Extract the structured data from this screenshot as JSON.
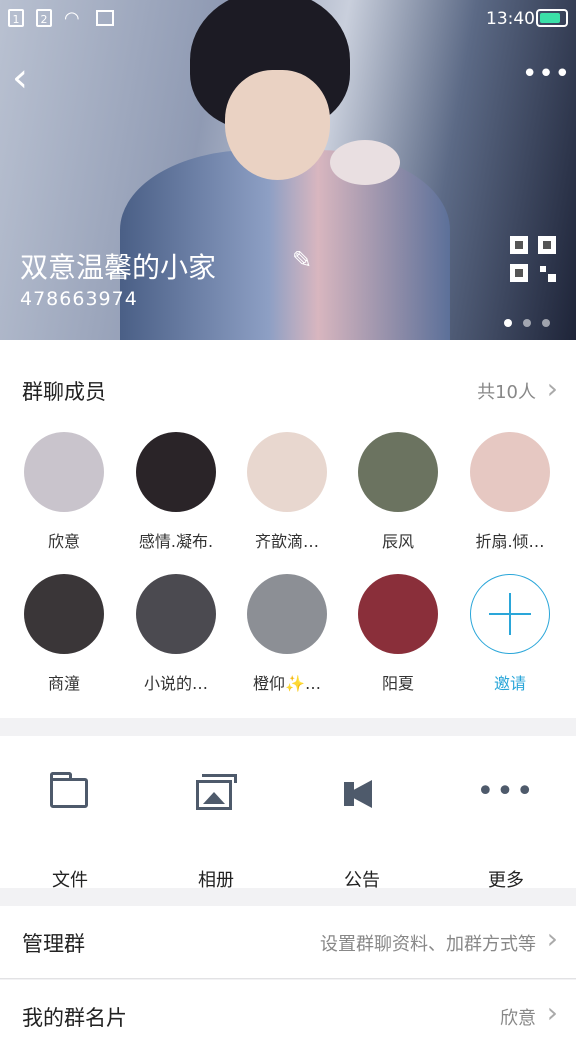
{
  "status_bar": {
    "sim1": "1",
    "sim2": "2",
    "time": "13:40",
    "battery_level": 0.85
  },
  "header": {
    "group_name": "双意温馨的小家",
    "group_id": "478663974",
    "page_count": 3,
    "active_page": 0
  },
  "members": {
    "title": "群聊成员",
    "count": "共10人",
    "list": [
      {
        "name": "欣意",
        "color": "#c9c4cc"
      },
      {
        "name": "感情.凝布.",
        "color": "#2a2428"
      },
      {
        "name": "齐歆滴…",
        "color": "#e8d7cf"
      },
      {
        "name": "辰风",
        "color": "#6b7360"
      },
      {
        "name": "折扇.倾…",
        "color": "#e6c8c2"
      },
      {
        "name": "商潼",
        "color": "#3a3638"
      },
      {
        "name": "小说的…",
        "color": "#4b4a50"
      },
      {
        "name": "橙仰✨…",
        "color": "#8c8f95"
      },
      {
        "name": "阳夏",
        "color": "#8a2f3a"
      }
    ],
    "invite_label": "邀请"
  },
  "actions": [
    {
      "label": "文件",
      "icon": "folder-icon"
    },
    {
      "label": "相册",
      "icon": "album-icon"
    },
    {
      "label": "公告",
      "icon": "announcement-icon"
    },
    {
      "label": "更多",
      "icon": "more-icon"
    }
  ],
  "manage": {
    "title": "管理群",
    "value": "设置群聊资料、加群方式等"
  },
  "card": {
    "title": "我的群名片",
    "value": "欣意"
  }
}
